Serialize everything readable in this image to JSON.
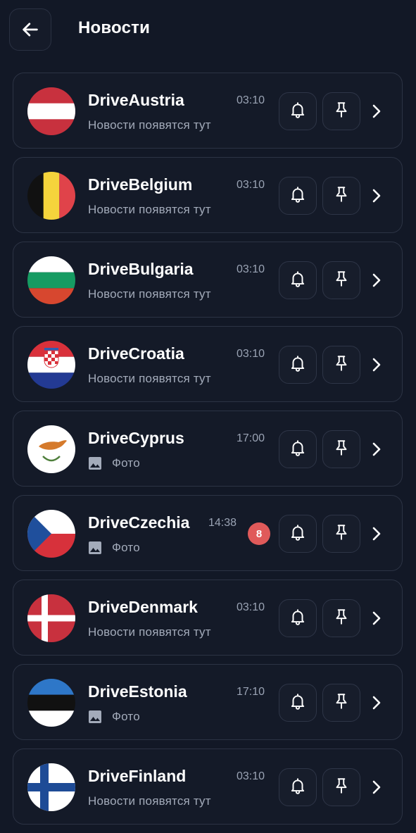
{
  "header": {
    "title": "Новости",
    "back_icon": "arrow-left-icon"
  },
  "channels": [
    {
      "name": "DriveAustria",
      "time": "03:10",
      "subtitle": "Новости появятся тут",
      "has_photo": false,
      "badge": "",
      "flag": "austria"
    },
    {
      "name": "DriveBelgium",
      "time": "03:10",
      "subtitle": "Новости появятся тут",
      "has_photo": false,
      "badge": "",
      "flag": "belgium"
    },
    {
      "name": "DriveBulgaria",
      "time": "03:10",
      "subtitle": "Новости появятся тут",
      "has_photo": false,
      "badge": "",
      "flag": "bulgaria"
    },
    {
      "name": "DriveCroatia",
      "time": "03:10",
      "subtitle": "Новости появятся тут",
      "has_photo": false,
      "badge": "",
      "flag": "croatia"
    },
    {
      "name": "DriveCyprus",
      "time": "17:00",
      "subtitle": "Фото",
      "has_photo": true,
      "badge": "",
      "flag": "cyprus"
    },
    {
      "name": "DriveCzechia",
      "time": "14:38",
      "subtitle": "Фото",
      "has_photo": true,
      "badge": "8",
      "flag": "czechia"
    },
    {
      "name": "DriveDenmark",
      "time": "03:10",
      "subtitle": "Новости появятся тут",
      "has_photo": false,
      "badge": "",
      "flag": "denmark"
    },
    {
      "name": "DriveEstonia",
      "time": "17:10",
      "subtitle": "Фото",
      "has_photo": true,
      "badge": "",
      "flag": "estonia"
    },
    {
      "name": "DriveFinland",
      "time": "03:10",
      "subtitle": "Новости появятся тут",
      "has_photo": false,
      "badge": "",
      "flag": "finland"
    }
  ],
  "icons": {
    "bell": "bell-icon",
    "pin": "pin-icon",
    "chevron": "chevron-right-icon",
    "photo": "image-icon"
  },
  "colors": {
    "background": "#121826",
    "card": "#141a28",
    "badge": "#e05a5a",
    "muted_text": "#a3abba"
  }
}
